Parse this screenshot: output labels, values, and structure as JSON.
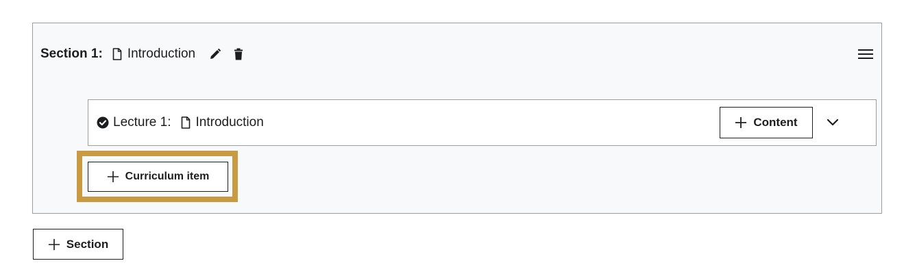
{
  "section": {
    "label": "Section 1:",
    "title": "Introduction",
    "icons": [
      "file-icon",
      "edit-icon",
      "trash-icon",
      "hamburger-menu-icon"
    ]
  },
  "lecture": {
    "label": "Lecture 1:",
    "title": "Introduction",
    "icons": [
      "check-circle-icon",
      "file-icon",
      "chevron-down-icon"
    ],
    "content_button_label": "Content"
  },
  "buttons": {
    "curriculum_item_label": "Curriculum item",
    "section_label": "Section"
  },
  "colors": {
    "text": "#1c1d1f",
    "section_background": "#f7f9fa",
    "border": "#9c9da0",
    "highlight": "#c89a42"
  }
}
